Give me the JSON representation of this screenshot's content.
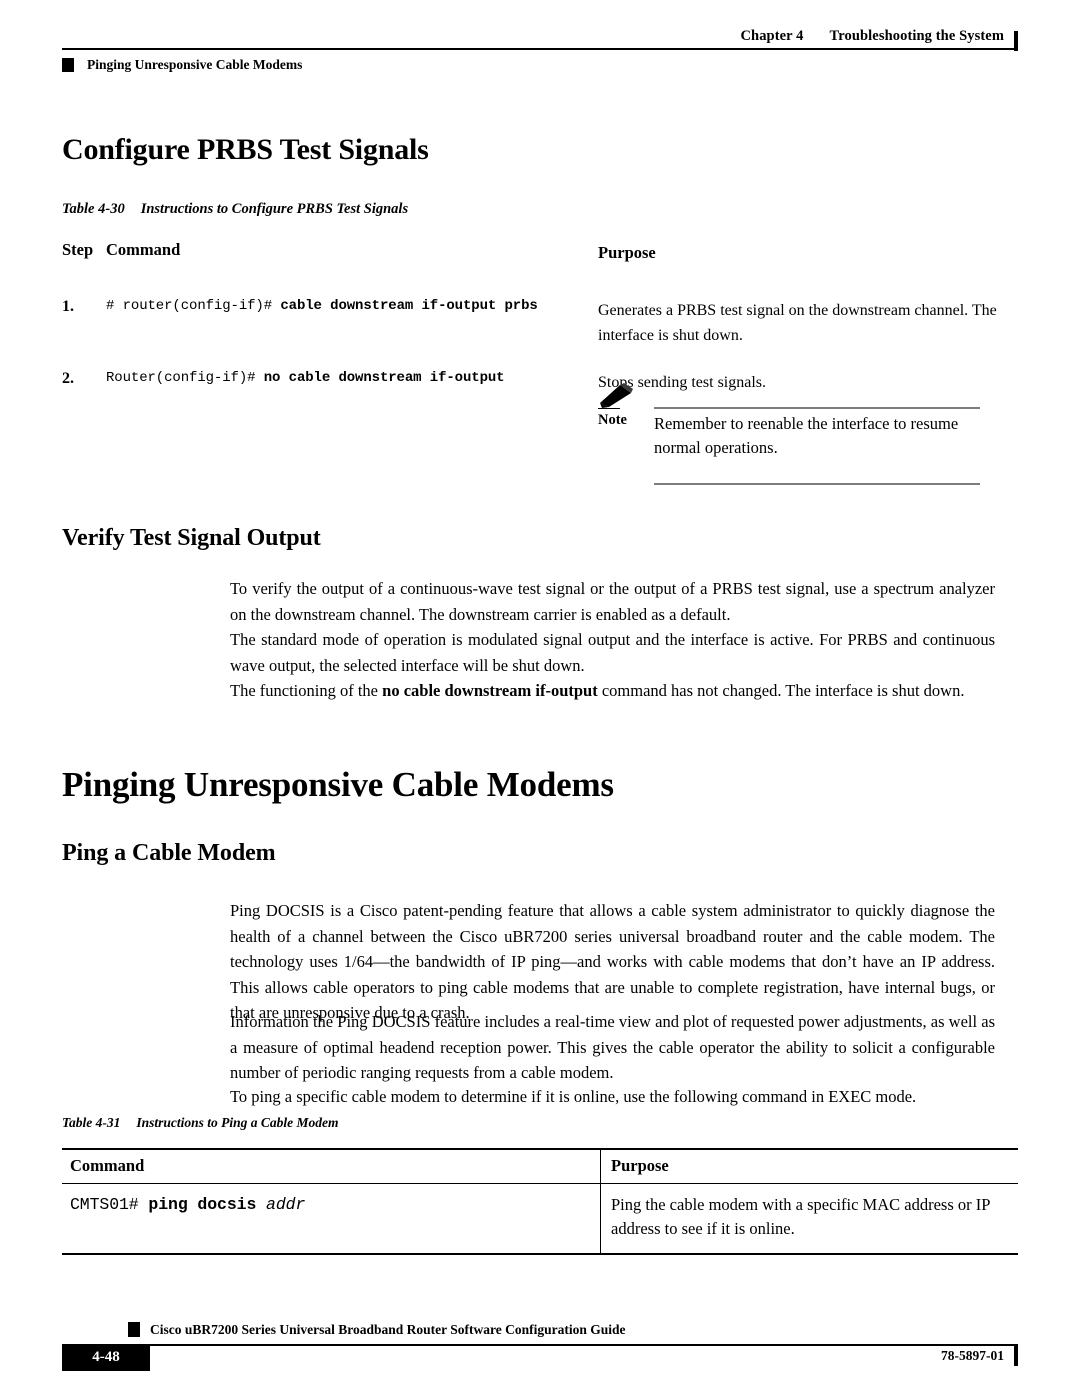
{
  "header": {
    "chapter": "Chapter 4",
    "chapter_title": "Troubleshooting the System",
    "running_head": "Pinging Unresponsive Cable Modems"
  },
  "sections": {
    "configure_prbs_heading": "Configure PRBS Test Signals",
    "verify_heading": "Verify Test Signal Output",
    "pinging_heading": "Pinging Unresponsive Cable Modems",
    "ping_modem_heading": "Ping a Cable Modem"
  },
  "table_4_30": {
    "caption_number": "Table 4-30",
    "caption_title": "Instructions to Configure PRBS Test Signals",
    "headers": {
      "step": "Step",
      "command": "Command",
      "purpose": "Purpose"
    },
    "rows": [
      {
        "step": "1.",
        "command_prompt": "# router(config-if)# ",
        "command_bold": "cable downstream if-output prbs",
        "purpose": "Generates a PRBS test signal on the downstream channel. The interface is shut down."
      },
      {
        "step": "2.",
        "command_prompt": "Router(config-if)# ",
        "command_bold": "no cable downstream if-output",
        "purpose": "Stops sending test signals."
      }
    ]
  },
  "note": {
    "label": "Note",
    "text": "Remember to reenable the interface to resume normal operations.",
    "icon": "pencil-icon"
  },
  "verify_paragraphs": {
    "p1": "To verify the output of a continuous-wave test signal or the output of a PRBS test signal, use a spectrum analyzer on the downstream channel. The downstream carrier is enabled as a default.",
    "p2": "The standard mode of operation is modulated signal output and the interface is active. For PRBS and continuous wave output, the selected interface will be shut down.",
    "p3_before": "The functioning of the ",
    "p3_bold": "no cable downstream if-output",
    "p3_after": " command has not changed. The interface is shut down."
  },
  "ping_paragraphs": {
    "p1": "Ping DOCSIS is a Cisco patent-pending feature that allows a cable system administrator to quickly diagnose the health of a channel between the Cisco uBR7200 series universal broadband router and the cable modem. The technology uses 1/64—the bandwidth of IP ping—and works with cable modems that don’t have an IP address. This allows cable operators to ping cable modems that are unable to complete registration, have internal bugs, or that are unresponsive due to a crash.",
    "p2": "Information the Ping DOCSIS feature includes a real-time view and plot of requested power adjustments, as well as a measure of optimal headend reception power. This gives the cable operator the ability to solicit a configurable number of periodic ranging requests from a cable modem.",
    "p3": "To ping a specific cable modem to determine if it is online, use the following command in EXEC mode."
  },
  "table_4_31": {
    "caption_number": "Table 4-31",
    "caption_title": "Instructions to Ping a Cable Modem",
    "headers": {
      "command": "Command",
      "purpose": "Purpose"
    },
    "rows": [
      {
        "command_prompt": "CMTS01# ",
        "command_bold": "ping docsis ",
        "command_italic": "addr",
        "purpose": "Ping the cable modem with a specific MAC address or IP address to see if it is online."
      }
    ]
  },
  "footer": {
    "guide_title": "Cisco uBR7200 Series Universal Broadband Router Software Configuration Guide",
    "page_number": "4-48",
    "document_id": "78-5897-01"
  }
}
